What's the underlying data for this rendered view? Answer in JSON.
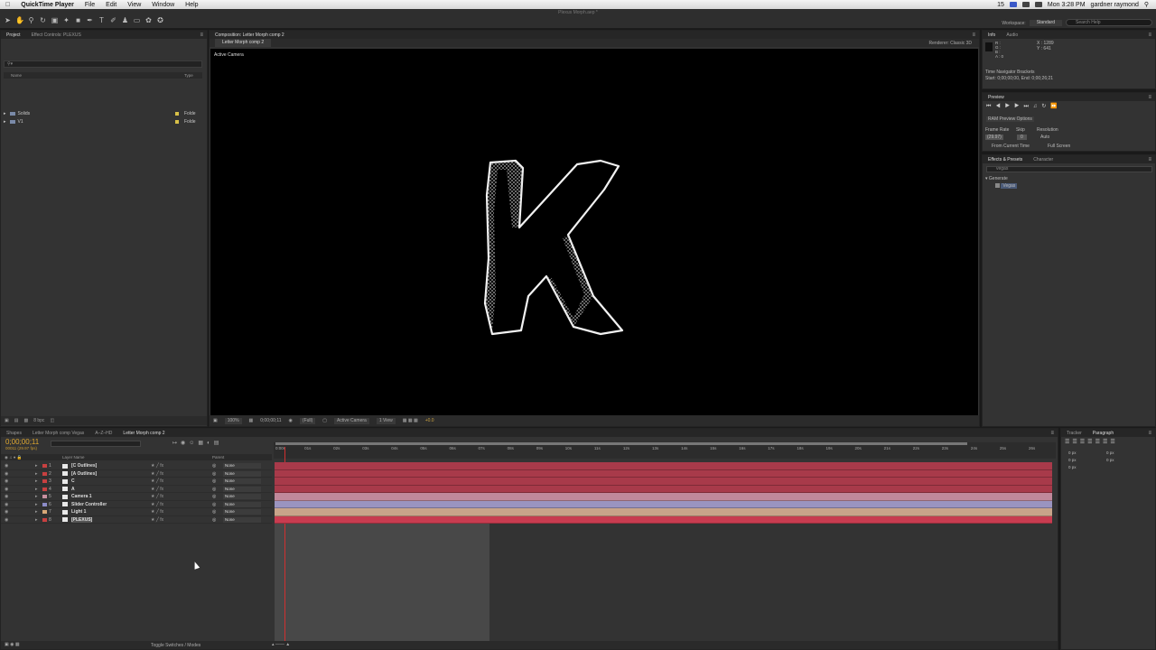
{
  "menubar": {
    "items": [
      "QuickTime Player",
      "File",
      "Edit",
      "View",
      "Window",
      "Help"
    ],
    "clock": "Mon 3:28 PM",
    "user": "gardner raymond",
    "battery": "15"
  },
  "app": {
    "document_title": "Plexus Morph.aep *",
    "workspace_label": "Workspace:",
    "workspace_value": "Standard",
    "search_placeholder": "Search Help"
  },
  "project_panel": {
    "tabs": [
      "Project",
      "Effect Controls: PLEXUS"
    ],
    "columns": [
      "Name",
      "Type"
    ],
    "items": [
      {
        "name": "Solids",
        "type": "Folde"
      },
      {
        "name": "V1",
        "type": "Folde"
      }
    ],
    "bpc": "8 bpc"
  },
  "composition_panel": {
    "tab": "Composition: Letter Morph comp 2",
    "subtab": "Letter Morph comp 2",
    "renderer_label": "Renderer:",
    "renderer_value": "Classic 3D",
    "view_label": "Active Camera",
    "footer": {
      "zoom": "100%",
      "timecode": "0;00;00;11",
      "resolution": "(Full)",
      "camera": "Active Camera",
      "views": "1 View",
      "exposure": "+0.0"
    }
  },
  "info_panel": {
    "tabs": [
      "Info",
      "Audio"
    ],
    "x": "X : 1289",
    "y": "Y : 641",
    "channels": [
      "R :",
      "G :",
      "B :",
      "A : 0"
    ],
    "line1": "Time Navigator Brackets",
    "line2": "Start: 0;00;00;00, End: 0;00;26;21"
  },
  "preview_panel": {
    "tab": "Preview",
    "ram_options": "RAM Preview Options",
    "frame_rate_label": "Frame Rate",
    "skip_label": "Skip",
    "resolution_label": "Resolution",
    "frame_rate": "(29.97)",
    "skip": "0",
    "resolution": "Auto",
    "from_current": "From Current Time",
    "full_screen": "Full Screen"
  },
  "effects_panel": {
    "tabs": [
      "Effects & Presets",
      "Character"
    ],
    "search": "vegas",
    "category": "Generate",
    "result": "Vegas"
  },
  "timeline": {
    "tabs": [
      "Shapes",
      "Letter Morph comp Vegas",
      "A–Z–HD",
      "Letter Morph comp 2"
    ],
    "timecode": "0;00;00;11",
    "fps": "00011 (29.97 fps)",
    "col_layer_name": "Layer Name",
    "col_parent": "Parent",
    "ruler": [
      "0:00s",
      "01s",
      "02s",
      "03s",
      "04s",
      "05s",
      "06s",
      "07s",
      "08s",
      "09s",
      "10s",
      "11s",
      "12s",
      "13s",
      "14s",
      "15s",
      "16s",
      "17s",
      "18s",
      "19s",
      "20s",
      "21s",
      "22s",
      "23s",
      "24s",
      "25s",
      "26s"
    ],
    "layers": [
      {
        "num": "1",
        "name": "[C Outlines]",
        "parent": "None",
        "label_color": "#c84040",
        "bar_color": "#a83a4a"
      },
      {
        "num": "2",
        "name": "[A Outlines]",
        "parent": "None",
        "label_color": "#c84040",
        "bar_color": "#a83a4a"
      },
      {
        "num": "3",
        "name": "C",
        "parent": "None",
        "label_color": "#c84040",
        "bar_color": "#a83a4a"
      },
      {
        "num": "4",
        "name": "A",
        "parent": "None",
        "label_color": "#c84040",
        "bar_color": "#a83a4a"
      },
      {
        "num": "5",
        "name": "Camera 1",
        "parent": "None",
        "label_color": "#c890a0",
        "bar_color": "#c0889a"
      },
      {
        "num": "6",
        "name": "Slider Controller",
        "parent": "None",
        "label_color": "#8c8cc8",
        "bar_color": "#9a94c0"
      },
      {
        "num": "7",
        "name": "Light 1",
        "parent": "None",
        "label_color": "#d8a878",
        "bar_color": "#c8a48a"
      },
      {
        "num": "8",
        "name": "[PLEXUS]",
        "parent": "None",
        "label_color": "#c84040",
        "bar_color": "#c83c50"
      }
    ],
    "footer_label": "Toggle Switches / Modes"
  },
  "paragraph_panel": {
    "tabs": [
      "Tracker",
      "Paragraph"
    ],
    "fields": [
      "0 px",
      "0 px",
      "0 px",
      "0 px",
      "0 px"
    ]
  }
}
